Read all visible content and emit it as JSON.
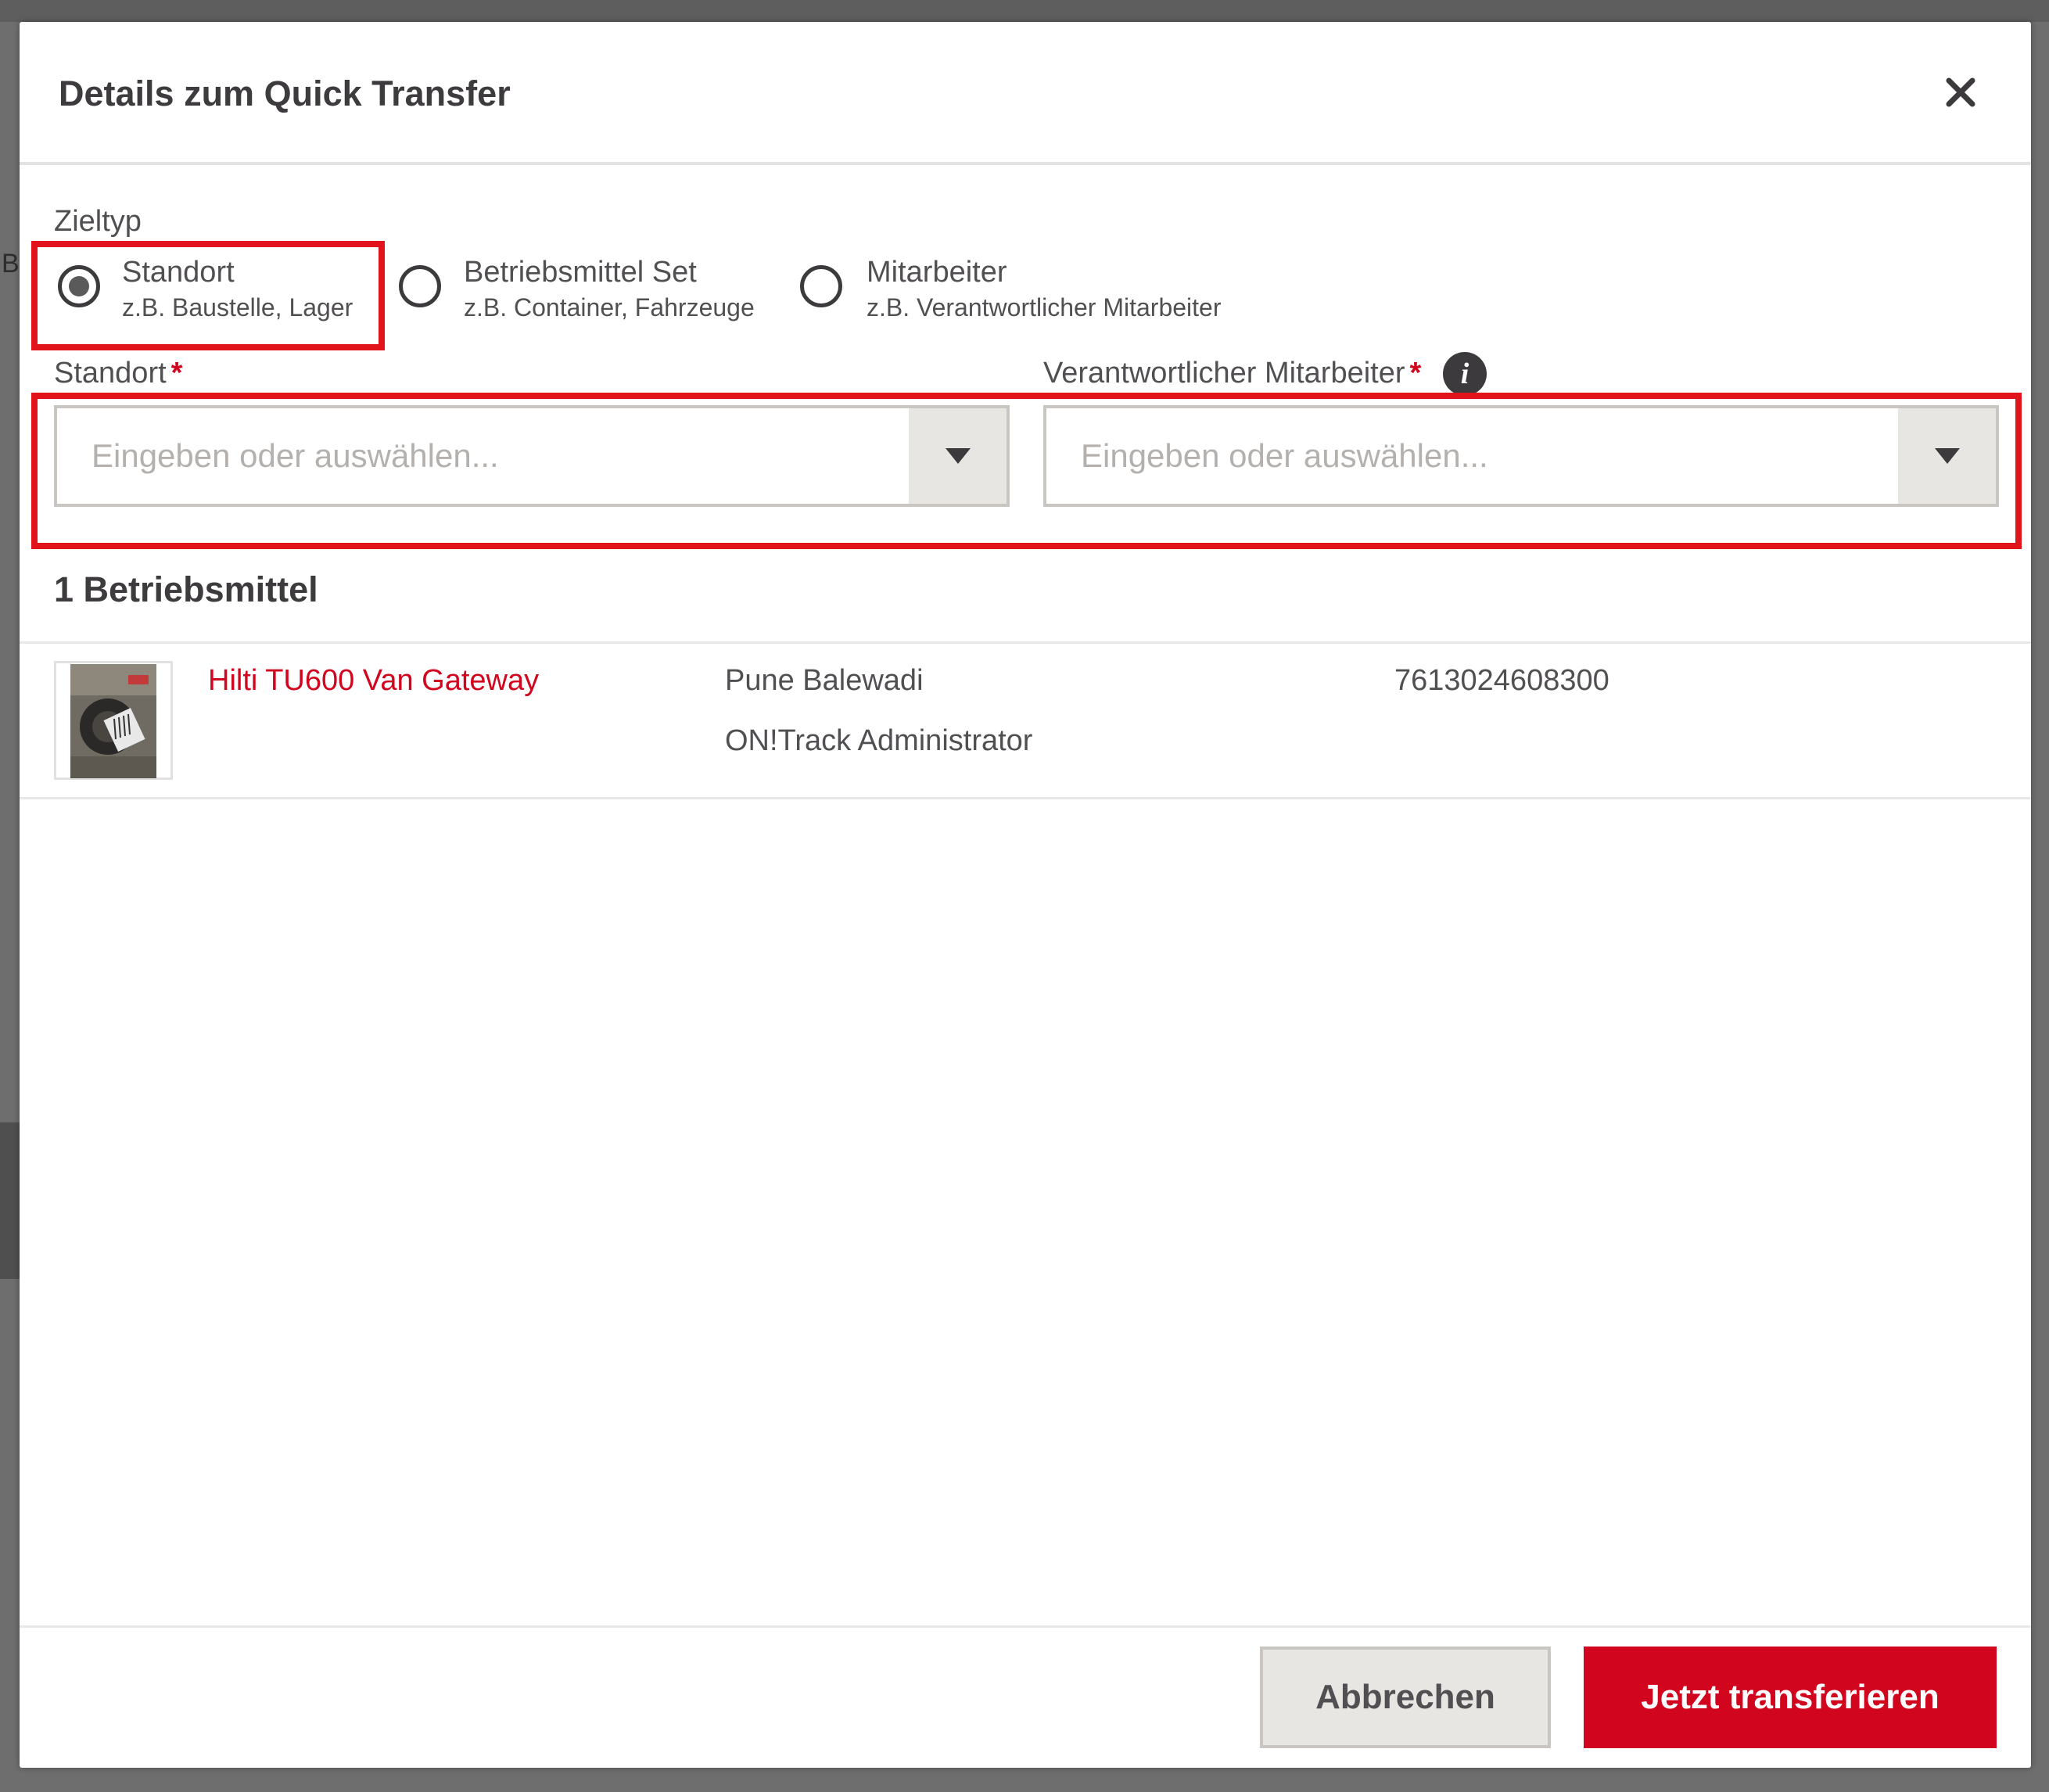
{
  "dialog": {
    "title": "Details zum Quick Transfer"
  },
  "target_type": {
    "label": "Zieltyp",
    "options": [
      {
        "title": "Standort",
        "subtitle": "z.B. Baustelle, Lager",
        "selected": true
      },
      {
        "title": "Betriebsmittel Set",
        "subtitle": "z.B. Container, Fahrzeuge",
        "selected": false
      },
      {
        "title": "Mitarbeiter",
        "subtitle": "z.B. Verantwortlicher Mitarbeiter",
        "selected": false
      }
    ]
  },
  "fields": {
    "location": {
      "label": "Standort",
      "required_mark": "*",
      "placeholder": "Eingeben oder auswählen...",
      "value": ""
    },
    "responsible": {
      "label": "Verantwortlicher Mitarbeiter",
      "required_mark": "*",
      "placeholder": "Eingeben oder auswählen...",
      "value": "",
      "info_icon": "i"
    }
  },
  "assets": {
    "heading": "1 Betriebsmittel",
    "items": [
      {
        "name": "Hilti TU600 Van Gateway",
        "location": "Pune Balewadi",
        "owner": "ON!Track Administrator",
        "code": "7613024608300"
      }
    ]
  },
  "footer": {
    "cancel_label": "Abbrechen",
    "submit_label": "Jetzt transferieren"
  },
  "background": {
    "partial_letter": "B"
  },
  "colors": {
    "accent": "#d2051e",
    "highlight": "#e2141b",
    "text": "#524f53",
    "button_gray": "#e7e6e2"
  }
}
